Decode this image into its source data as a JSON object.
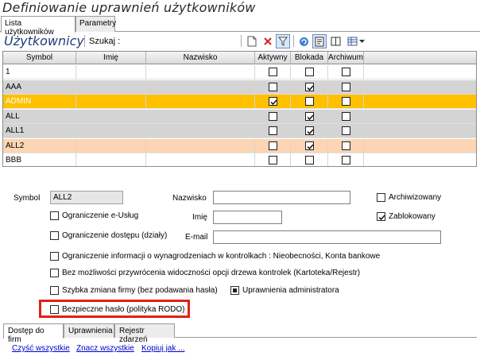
{
  "window": {
    "title": "Definiowanie uprawnień użytkowników"
  },
  "top_tabs": [
    {
      "label": "Lista użytkowników",
      "active": true
    },
    {
      "label": "Parametry",
      "active": false
    }
  ],
  "toolbar": {
    "title": "Użytkownicy",
    "search_label": "Szukaj :",
    "icons": [
      "new-document-icon",
      "delete-icon",
      "filter-icon",
      "refresh-icon",
      "export-icon",
      "columns-icon",
      "view-options-icon"
    ]
  },
  "grid": {
    "columns": [
      "Symbol",
      "Imię",
      "Nazwisko",
      "Aktywny",
      "Blokada",
      "Archiwum"
    ],
    "rows": [
      {
        "symbol": "1",
        "imie": "",
        "nazwisko": "",
        "aktywny": false,
        "blokada": false,
        "archiwum": false,
        "style": "white"
      },
      {
        "symbol": "AAA",
        "imie": "",
        "nazwisko": "",
        "aktywny": false,
        "blokada": true,
        "archiwum": false,
        "style": "gray"
      },
      {
        "symbol": "ADMIN",
        "imie": "",
        "nazwisko": "",
        "aktywny": true,
        "blokada": false,
        "archiwum": false,
        "style": "selected"
      },
      {
        "symbol": "ALL",
        "imie": "",
        "nazwisko": "",
        "aktywny": false,
        "blokada": true,
        "archiwum": false,
        "style": "gray"
      },
      {
        "symbol": "ALL1",
        "imie": "",
        "nazwisko": "",
        "aktywny": false,
        "blokada": true,
        "archiwum": false,
        "style": "gray"
      },
      {
        "symbol": "ALL2",
        "imie": "",
        "nazwisko": "",
        "aktywny": false,
        "blokada": true,
        "archiwum": false,
        "style": "peach"
      },
      {
        "symbol": "BBB",
        "imie": "",
        "nazwisko": "",
        "aktywny": false,
        "blokada": false,
        "archiwum": false,
        "style": "white"
      }
    ],
    "colors": {
      "selected": "#ffc000",
      "gray": "#d4d4d4",
      "peach": "#fcd5b4",
      "white": "#ffffff"
    }
  },
  "form": {
    "symbol_label": "Symbol",
    "symbol_value": "ALL2",
    "nazwisko_label": "Nazwisko",
    "nazwisko_value": "",
    "imie_label": "Imię",
    "imie_value": "",
    "email_label": "E-mail",
    "email_value": "",
    "archiwizowany": {
      "label": "Archiwizowany",
      "checked": false
    },
    "zablokowany": {
      "label": "Zablokowany",
      "checked": true
    },
    "ogr_eusług": {
      "label": "Ograniczenie e-Usług",
      "checked": false
    },
    "ogr_dostepu": {
      "label": "Ograniczenie dostępu (działy)",
      "checked": false
    },
    "ogr_wynagr": {
      "label": "Ograniczenie informacji o wynagrodzeniach w kontrolkach : Nieobecności, Konta bankowe",
      "checked": false
    },
    "bez_przywrocenia": {
      "label": "Bez możliwości przywrócenia widoczności opcji drzewa kontrolek (Kartoteka/Rejestr)",
      "checked": false
    },
    "szybka_zmiana": {
      "label": "Szybka zmiana firmy (bez podawania hasła)",
      "checked": false
    },
    "uprawnienia_admin": {
      "label": "Uprawnienia administratora",
      "checked": false,
      "indeterminate": true
    },
    "bezpieczne_haslo": {
      "label": "Bezpieczne hasło (polityka RODO)",
      "checked": false
    }
  },
  "bottom_tabs": [
    {
      "label": "Dostęp do firm",
      "active": true
    },
    {
      "label": "Uprawnienia",
      "active": false
    },
    {
      "label": "Rejestr zdarzeń",
      "active": false
    }
  ],
  "links": [
    "Czyść wszystkie",
    "Znacz wszystkie",
    "Kopiuj jak ..."
  ]
}
